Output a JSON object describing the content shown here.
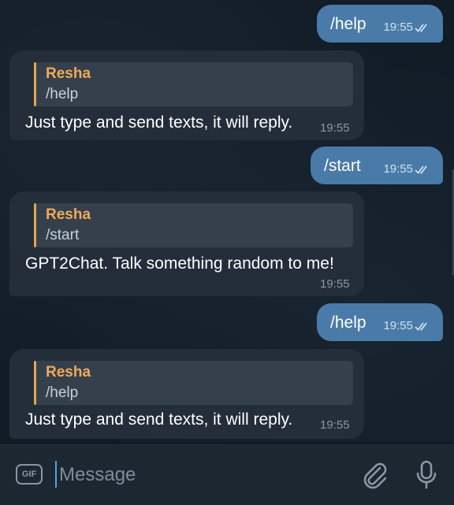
{
  "messages": [
    {
      "direction": "out",
      "text": "/help",
      "time": "19:55"
    },
    {
      "direction": "in",
      "reply_name": "Resha",
      "reply_text": "/help",
      "text": "Just type and send texts, it will reply.",
      "time": "19:55"
    },
    {
      "direction": "out",
      "text": "/start",
      "time": "19:55"
    },
    {
      "direction": "in",
      "reply_name": "Resha",
      "reply_text": "/start",
      "text": "GPT2Chat. Talk something random to me!",
      "time": "19:55"
    },
    {
      "direction": "out",
      "text": "/help",
      "time": "19:55"
    },
    {
      "direction": "in",
      "reply_name": "Resha",
      "reply_text": "/help",
      "text": "Just type and send texts, it will reply.",
      "time": "19:55"
    }
  ],
  "composer": {
    "gif_label": "GIF",
    "placeholder": "Message",
    "value": ""
  },
  "icons": {
    "read_status": "double-check-icon",
    "attach": "paperclip-icon",
    "voice": "microphone-icon",
    "gif": "gif-icon"
  },
  "colors": {
    "outgoing_bubble": "#4a7aa8",
    "incoming_bubble": "#232e3a",
    "reply_accent": "#e6a34a",
    "reply_name": "#f0a957",
    "background": "#111c27",
    "composer": "#1c2732"
  }
}
